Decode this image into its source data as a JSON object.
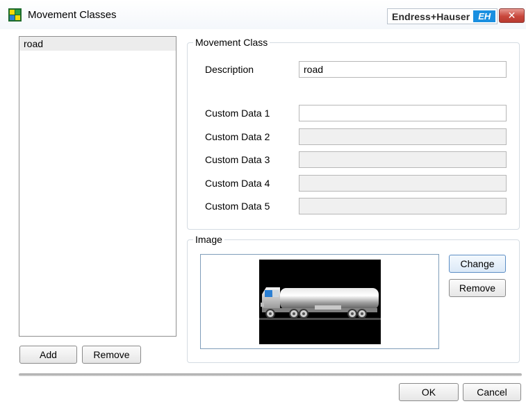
{
  "window": {
    "title": "Movement Classes",
    "brand_name": "Endress+Hauser",
    "brand_logo": "EH",
    "close_glyph": "✕"
  },
  "list": {
    "items": [
      "road"
    ],
    "add_label": "Add",
    "remove_label": "Remove"
  },
  "movement_class": {
    "legend": "Movement Class",
    "description_label": "Description",
    "description_value": "road",
    "custom_fields": [
      {
        "label": "Custom Data 1",
        "value": "",
        "enabled": true
      },
      {
        "label": "Custom Data 2",
        "value": "",
        "enabled": false
      },
      {
        "label": "Custom Data 3",
        "value": "",
        "enabled": false
      },
      {
        "label": "Custom Data 4",
        "value": "",
        "enabled": false
      },
      {
        "label": "Custom Data 5",
        "value": "",
        "enabled": false
      }
    ]
  },
  "image": {
    "legend": "Image",
    "change_label": "Change",
    "remove_label": "Remove",
    "picture": "tanker-truck-icon"
  },
  "footer": {
    "ok_label": "OK",
    "cancel_label": "Cancel"
  },
  "colors": {
    "accent_blue": "#1a8fe0",
    "close_red": "#c8473c",
    "focus_border": "#5b8dc4"
  }
}
